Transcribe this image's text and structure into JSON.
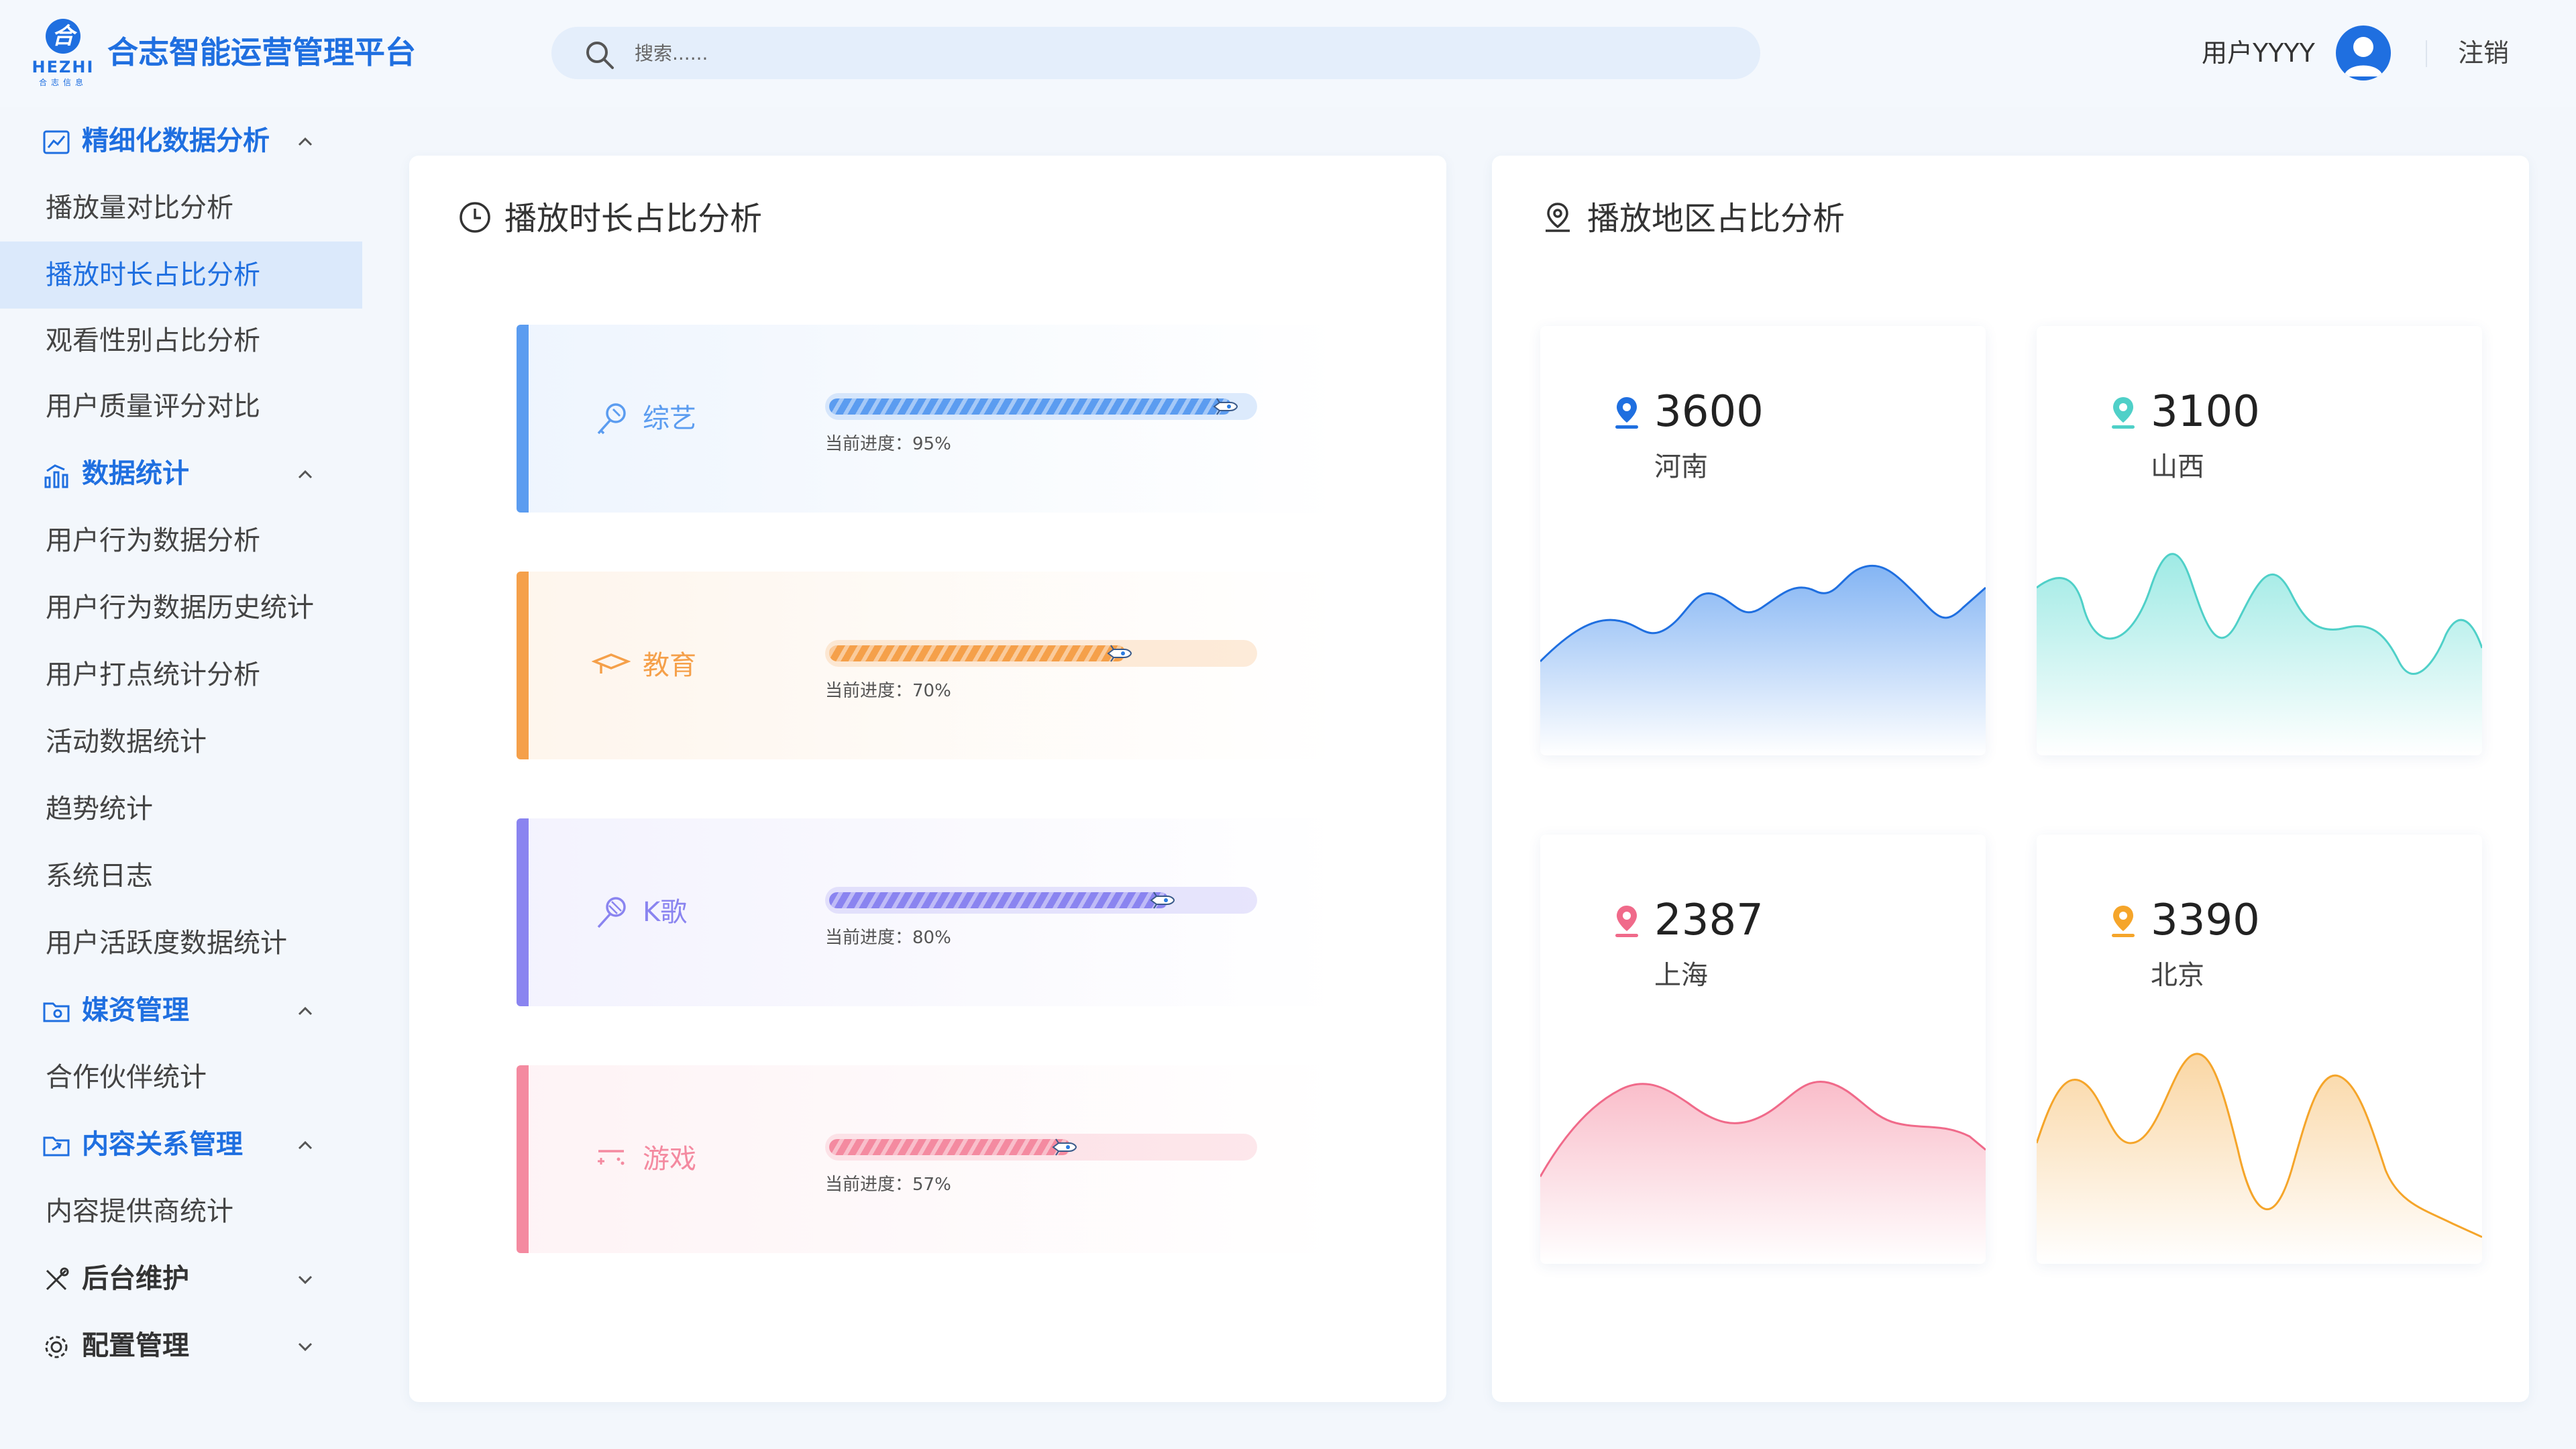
{
  "header": {
    "logo_glyph": "合",
    "logo_text": "HEZHI",
    "logo_sub": "合志信息",
    "title": "合志智能运营管理平台",
    "search_placeholder": "搜索......",
    "username": "用户YYYY",
    "logout": "注销"
  },
  "sidebar": {
    "groups": [
      {
        "label": "精细化数据分析",
        "icon": "trend-chart-icon",
        "expanded": true,
        "items": [
          "播放量对比分析",
          "播放时长占比分析",
          "观看性别占比分析",
          "用户质量评分对比"
        ]
      },
      {
        "label": "数据统计",
        "icon": "bar-chart-icon",
        "expanded": true,
        "items": [
          "用户行为数据分析",
          "用户行为数据历史统计",
          "用户打点统计分析",
          "活动数据统计",
          "趋势统计",
          "系统日志",
          "用户活跃度数据统计"
        ]
      },
      {
        "label": "媒资管理",
        "icon": "folder-icon",
        "expanded": true,
        "items": [
          "合作伙伴统计"
        ]
      },
      {
        "label": "内容关系管理",
        "icon": "folder-link-icon",
        "expanded": true,
        "items": [
          "内容提供商统计"
        ]
      },
      {
        "label": "后台维护",
        "icon": "tools-icon",
        "expanded": false,
        "items": []
      },
      {
        "label": "配置管理",
        "icon": "settings-icon",
        "expanded": false,
        "items": []
      }
    ],
    "active_item": "播放时长占比分析"
  },
  "duration_panel": {
    "title": "播放时长占比分析",
    "progress_prefix": "当前进度：",
    "items": [
      {
        "label": "综艺",
        "icon": "microphone-icon",
        "percent": 95,
        "text": "当前进度：95%",
        "color": "#5b9cf0"
      },
      {
        "label": "教育",
        "icon": "graduation-cap-icon",
        "percent": 70,
        "text": "当前进度：70%",
        "color": "#f5a04a"
      },
      {
        "label": "K歌",
        "icon": "karaoke-mic-icon",
        "percent": 80,
        "text": "当前进度：80%",
        "color": "#8a84f0"
      },
      {
        "label": "游戏",
        "icon": "gamepad-icon",
        "percent": 57,
        "text": "当前进度：57%",
        "color": "#f48aa0"
      }
    ]
  },
  "region_panel": {
    "title": "播放地区占比分析",
    "regions": [
      {
        "value": "3600",
        "name": "河南",
        "color": "#1f6fe0",
        "fill": "#5b9cf0"
      },
      {
        "value": "3100",
        "name": "山西",
        "color": "#4fd0c8",
        "fill": "#7fe3dc"
      },
      {
        "value": "2387",
        "name": "上海",
        "color": "#f06a8a",
        "fill": "#f7a7b8"
      },
      {
        "value": "3390",
        "name": "北京",
        "color": "#f5a52a",
        "fill": "#f8c986"
      }
    ]
  }
}
